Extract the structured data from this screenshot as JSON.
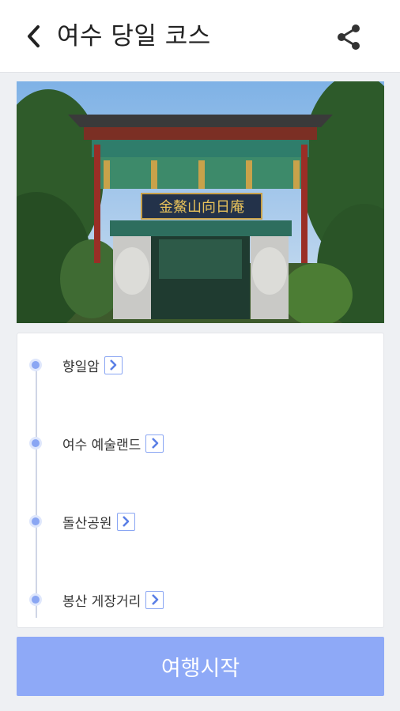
{
  "header": {
    "title": "여수 당일 코스",
    "back_icon": "chevron-left-icon",
    "share_icon": "share-icon"
  },
  "hero": {
    "image_description": "traditional Korean temple gate with hanging signboard",
    "signboard_text": "金鰲山向日庵"
  },
  "course": {
    "stops": [
      {
        "label": "향일암"
      },
      {
        "label": "여수 예술랜드"
      },
      {
        "label": "돌산공원"
      },
      {
        "label": "봉산 게장거리"
      }
    ]
  },
  "actions": {
    "start_label": "여행시작"
  },
  "colors": {
    "accent": "#8ea9f7",
    "dot": "#8aa6f3",
    "background": "#eef0f3"
  }
}
